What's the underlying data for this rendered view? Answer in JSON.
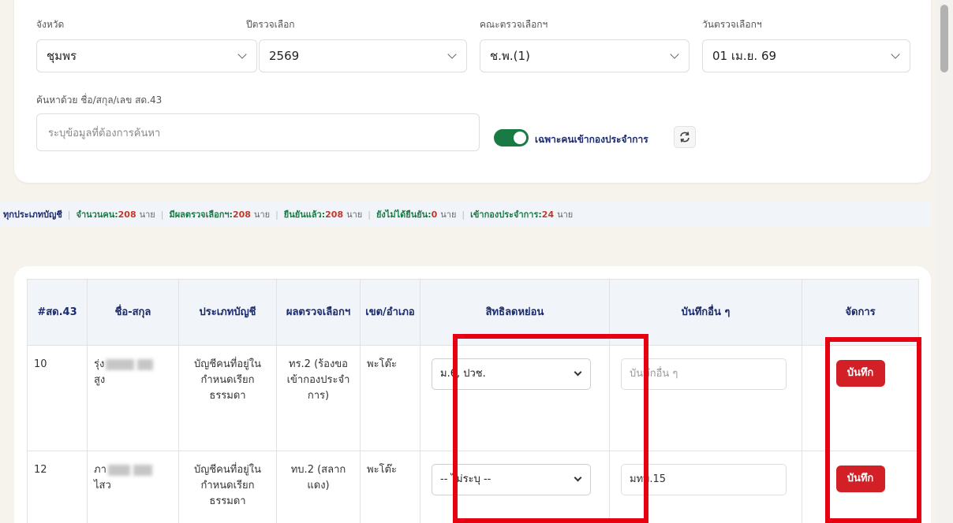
{
  "filters": {
    "province": {
      "label": "จังหวัด",
      "value": "ชุมพร"
    },
    "year": {
      "label": "ปีตรวจเลือก",
      "value": "2569"
    },
    "committee": {
      "label": "คณะตรวจเลือกฯ",
      "value": "ช.พ.(1)"
    },
    "date": {
      "label": "วันตรวจเลือกฯ",
      "value": "01 เม.ย. 69"
    },
    "search": {
      "label": "ค้นหาด้วย ชื่อ/สกุล/เลข สด.43",
      "placeholder": "ระบุข้อมูลที่ต้องการค้นหา"
    },
    "toggle_label": "เฉพาะคนเข้ากองประจำการ"
  },
  "summary": {
    "account_type": "ทุกประเภทบัญชี",
    "items": [
      {
        "label": "จำนวนคน:",
        "value": "208",
        "unit": "นาย"
      },
      {
        "label": "มีผลตรวจเลือกฯ:",
        "value": "208",
        "unit": "นาย"
      },
      {
        "label": "ยืนยันแล้ว:",
        "value": "208",
        "unit": "นาย"
      },
      {
        "label": "ยังไม่ได้ยืนยัน:",
        "value": "0",
        "unit": "นาย"
      },
      {
        "label": "เข้ากองประจำการ:",
        "value": "24",
        "unit": "นาย"
      }
    ]
  },
  "table": {
    "headers": [
      "#สด.43",
      "ชื่อ-สกุล",
      "ประเภทบัญชี",
      "ผลตรวจเลือกฯ",
      "เขต/อำเภอ",
      "สิทธิลดหย่อน",
      "บันทึกอื่น ๆ",
      "จัดการ"
    ],
    "rows": [
      {
        "id": "10",
        "name_first": "รุ่ง",
        "name_last": "สูง",
        "account": "บัญชีคนที่อยู่ในกำหนดเรียกธรรมดา",
        "result": "ทร.2 (ร้องขอเข้ากองประจำการ)",
        "district": "พะโต๊ะ",
        "privilege": "ม.6, ปวช.",
        "note_value": "",
        "note_placeholder": "บันทึกอื่น ๆ",
        "action": "บันทึก"
      },
      {
        "id": "12",
        "name_first": "ภา",
        "name_last": "ไสว",
        "account": "บัญชีคนที่อยู่ในกำหนดเรียกธรรมดา",
        "result": "ทบ.2 (สลากแดง)",
        "district": "พะโต๊ะ",
        "privilege": "-- ไม่ระบุ --",
        "note_value": "มทบ.15",
        "note_placeholder": "บันทึกอื่น ๆ",
        "action": "บันทึก"
      }
    ]
  },
  "colors": {
    "primary_green": "#1a7a43",
    "navy": "#1a2a6e",
    "save_red": "#d32027",
    "highlight_red": "#e60012"
  }
}
